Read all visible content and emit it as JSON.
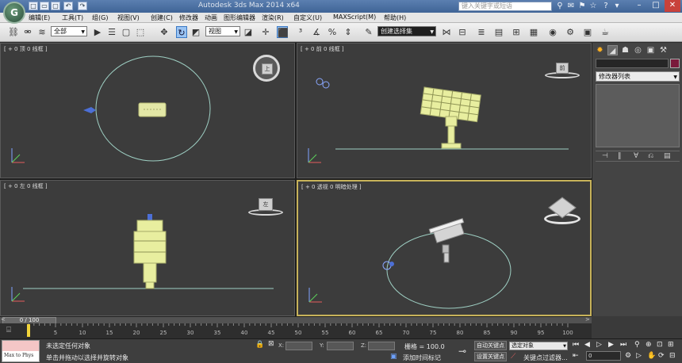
{
  "title_bar": {
    "logo_letter": "G",
    "window_title": "Autodesk 3ds Max 2014 x64",
    "search_placeholder": "键入关键字或短语",
    "quick_access": [
      "□",
      "▭",
      "▢",
      "↶",
      "↷"
    ],
    "minimize": "–",
    "maximize": "□",
    "close": "✕"
  },
  "menu": {
    "items": [
      "编辑(E)",
      "工具(T)",
      "组(G)",
      "视图(V)",
      "创建(C)",
      "修改器",
      "动画",
      "图形编辑器",
      "渲染(R)",
      "自定义(U)",
      "MAXScript(M)",
      "帮助(H)"
    ]
  },
  "toolbar": {
    "selection_filter": "全部",
    "reference_coord": "视图",
    "named_selection": "创建选择集"
  },
  "viewports": {
    "top": {
      "label": "[ + 0 顶 0 线框 ]",
      "cube_label": "上"
    },
    "front": {
      "label": "[ + 0 前 0 线框 ]",
      "cube_label": "前"
    },
    "left": {
      "label": "[ + 0 左 0 线框 ]",
      "cube_label": "左"
    },
    "perspective": {
      "label": "[ + 0 透视 0 明暗处理 ]"
    }
  },
  "command_panel": {
    "modifier_list": "修改器列表"
  },
  "timeline": {
    "thumb_label": "0 / 100",
    "ticks": [
      "0",
      "5",
      "10",
      "15",
      "20",
      "25",
      "30",
      "35",
      "40",
      "45",
      "50",
      "55",
      "60",
      "65",
      "70",
      "75",
      "80",
      "85",
      "90",
      "95",
      "100"
    ]
  },
  "status": {
    "maxscript_label": "Max to Phys",
    "selection_status": "未选定任何对象",
    "prompt": "单击并拖动以选择并旋转对象",
    "x_label": "X:",
    "y_label": "Y:",
    "z_label": "Z:",
    "grid": "栅格 = 100.0",
    "add_time_tag": "添加时间标记",
    "auto_key": "自动关键点",
    "set_key": "设置关键点",
    "selected_object": "选定对象",
    "key_filters": "关键点过滤器...",
    "frame": "0"
  }
}
